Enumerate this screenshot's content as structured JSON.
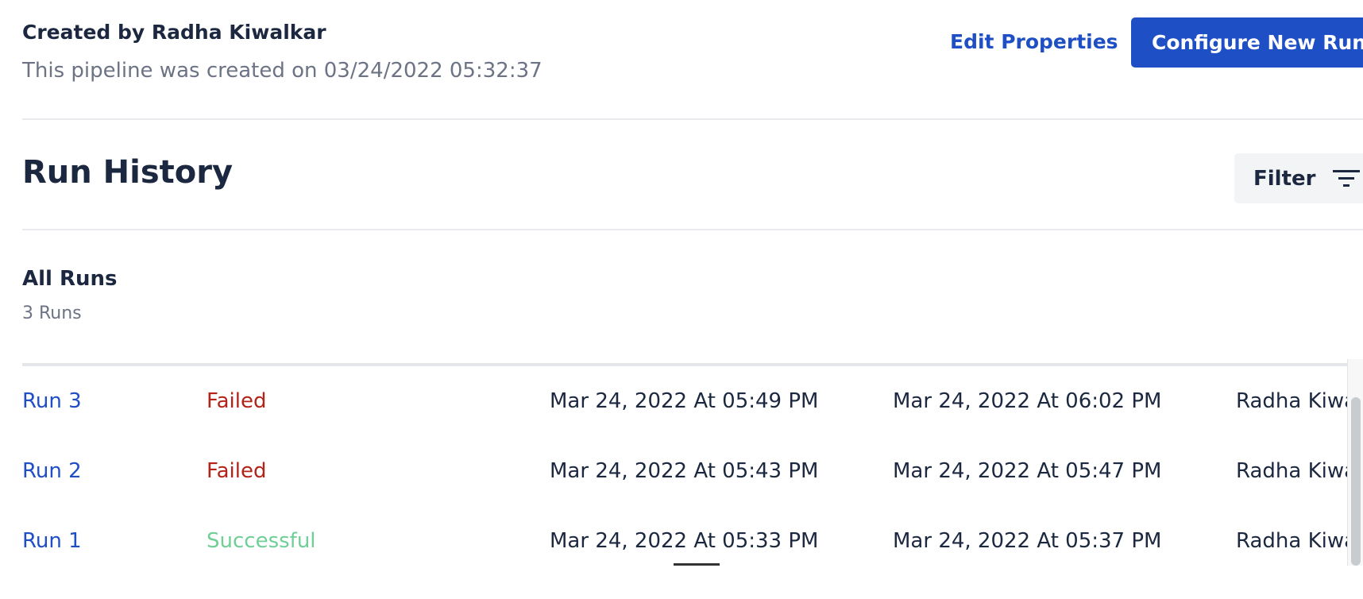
{
  "header": {
    "created_by": "Created by Radha Kiwalkar",
    "created_on": "This pipeline was created on 03/24/2022 05:32:37",
    "edit_properties": "Edit Properties",
    "configure_new_run": "Configure New Run"
  },
  "run_history": {
    "title": "Run History",
    "filter_label": "Filter",
    "filter_icon": "filter-icon"
  },
  "all_runs": {
    "title": "All Runs",
    "count": "3 Runs"
  },
  "colors": {
    "accent": "#1f4fc4",
    "failed": "#b42318",
    "successful": "#6fcf97"
  },
  "runs": [
    {
      "name": "Run 3",
      "status": "Failed",
      "start": "Mar 24, 2022 At 05:49 PM",
      "end": "Mar 24, 2022 At 06:02 PM",
      "user": "Radha Kiwa"
    },
    {
      "name": "Run 2",
      "status": "Failed",
      "start": "Mar 24, 2022 At 05:43 PM",
      "end": "Mar 24, 2022 At 05:47 PM",
      "user": "Radha Kiwa"
    },
    {
      "name": "Run 1",
      "status": "Successful",
      "start": "Mar 24, 2022 At 05:33 PM",
      "end": "Mar 24, 2022 At 05:37 PM",
      "user": "Radha Kiwa"
    }
  ]
}
